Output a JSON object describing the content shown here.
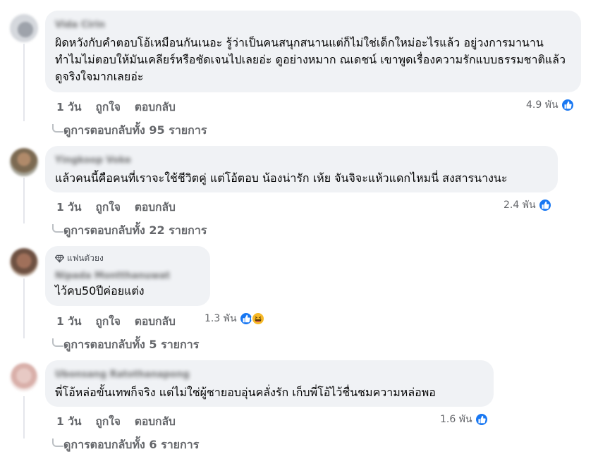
{
  "comments": [
    {
      "author": "Vida Cirin",
      "text": "ผิดหวังกับคำตอบโอ้เหมือนกันเนอะ รู้ว่าเป็นคนสนุกสนานแต่ก็ไม่ใช่เด็กใหม่อะไรแล้ว อยู่วงการมานาน ทำไมไม่ตอบให้มันเคลียร์หรือชัดเจนไปเลยอ่ะ ดูอย่างหมาก ณเดชน์ เขาพูดเรื่องความรักแบบธรรมชาติแล้วดูจริงใจมากเลยอ่ะ",
      "time": "1 วัน",
      "like": "ถูกใจ",
      "reply": "ตอบกลับ",
      "reaction_count": "4.9 พัน",
      "view_replies": "ดูการตอบกลับทั้ง 95 รายการ"
    },
    {
      "author": "Yingkoop Voke",
      "text": "แล้วคนนี้คือคนที่เราจะใช้ชีวิตคู่ แต่โอ้ตอบ น้องน่ารัก เห้ย จันจิจะแห้วแดกไหมนี่ สงสารนางนะ",
      "time": "1 วัน",
      "like": "ถูกใจ",
      "reply": "ตอบกลับ",
      "reaction_count": "2.4 พัน",
      "view_replies": "ดูการตอบกลับทั้ง 22 รายการ"
    },
    {
      "badge": "แฟนตัวยง",
      "author": "Nipada Montthanuwat",
      "text": "ไว้คบ50ปีค่อยแต่ง",
      "time": "1 วัน",
      "like": "ถูกใจ",
      "reply": "ตอบกลับ",
      "reaction_count": "1.3 พัน",
      "view_replies": "ดูการตอบกลับทั้ง 5 รายการ"
    },
    {
      "author": "Ubonsang Ratothanapong",
      "text": "พี่โอ้หล่อขั้นเทพก็จริง แต่ไม่ใช่ผู้ชายอบอุ่นคลั่งรัก เก็บพี่โอ้ไว้ชื่นชมความหล่อพอ",
      "time": "1 วัน",
      "like": "ถูกใจ",
      "reply": "ตอบกลับ",
      "reaction_count": "1.6 พัน",
      "view_replies": "ดูการตอบกลับทั้ง 6 รายการ"
    }
  ],
  "colors": {
    "like_blue": "#1877f2",
    "haha_yellow": "#f7b928",
    "bubble": "#f0f2f5",
    "meta_gray": "#65676b"
  },
  "icons": {
    "like": "like-icon",
    "haha": "haha-icon",
    "badge": "diamond-icon"
  }
}
